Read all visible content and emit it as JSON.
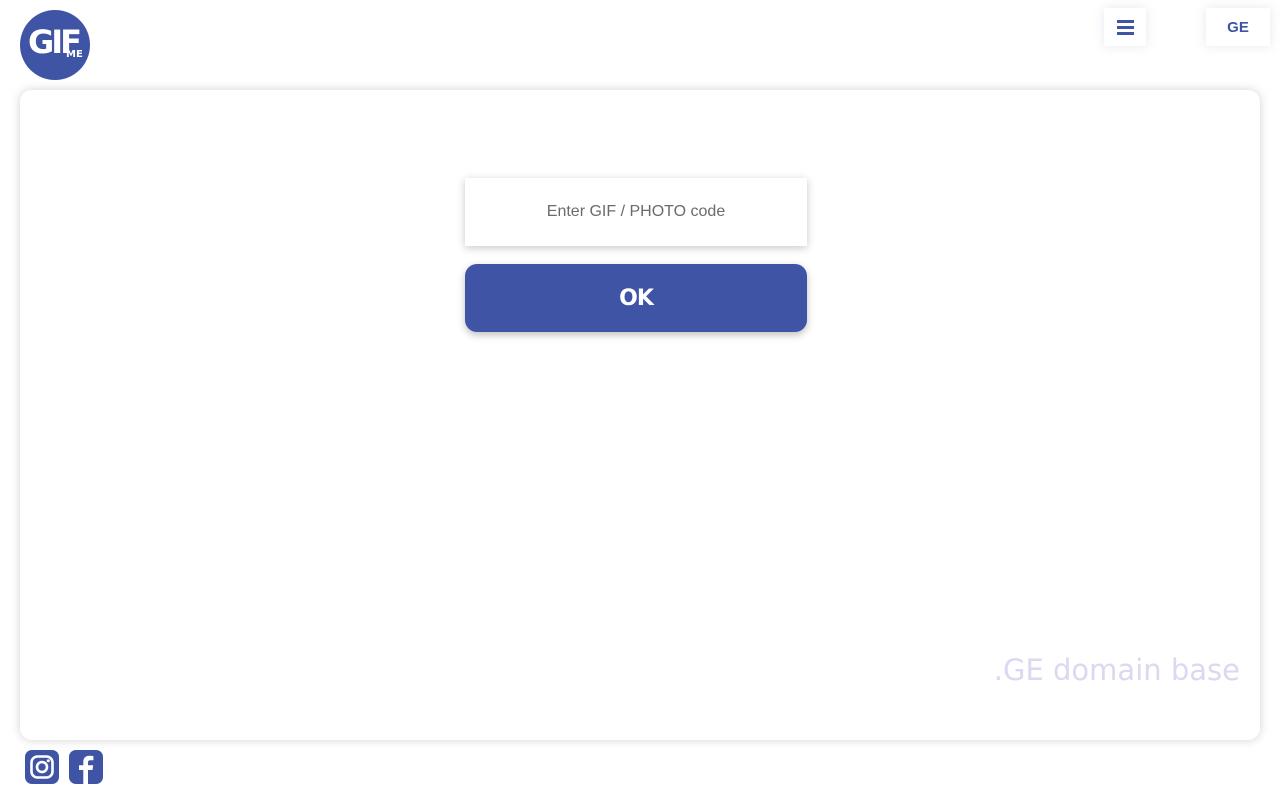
{
  "brand": {
    "logo_main": "GIF",
    "logo_sub": "ME",
    "accent_color": "#3f54a5"
  },
  "header": {
    "menu_icon": "hamburger-menu-icon",
    "language_label": "GE"
  },
  "form": {
    "code_placeholder": "Enter GIF / PHOTO code",
    "code_value": "",
    "submit_label": "OK"
  },
  "card": {
    "domain_note": ".GE domain base",
    "domain_note_color": "#ddd7f1"
  },
  "social": {
    "icons": [
      "instagram-icon",
      "facebook-icon"
    ]
  }
}
